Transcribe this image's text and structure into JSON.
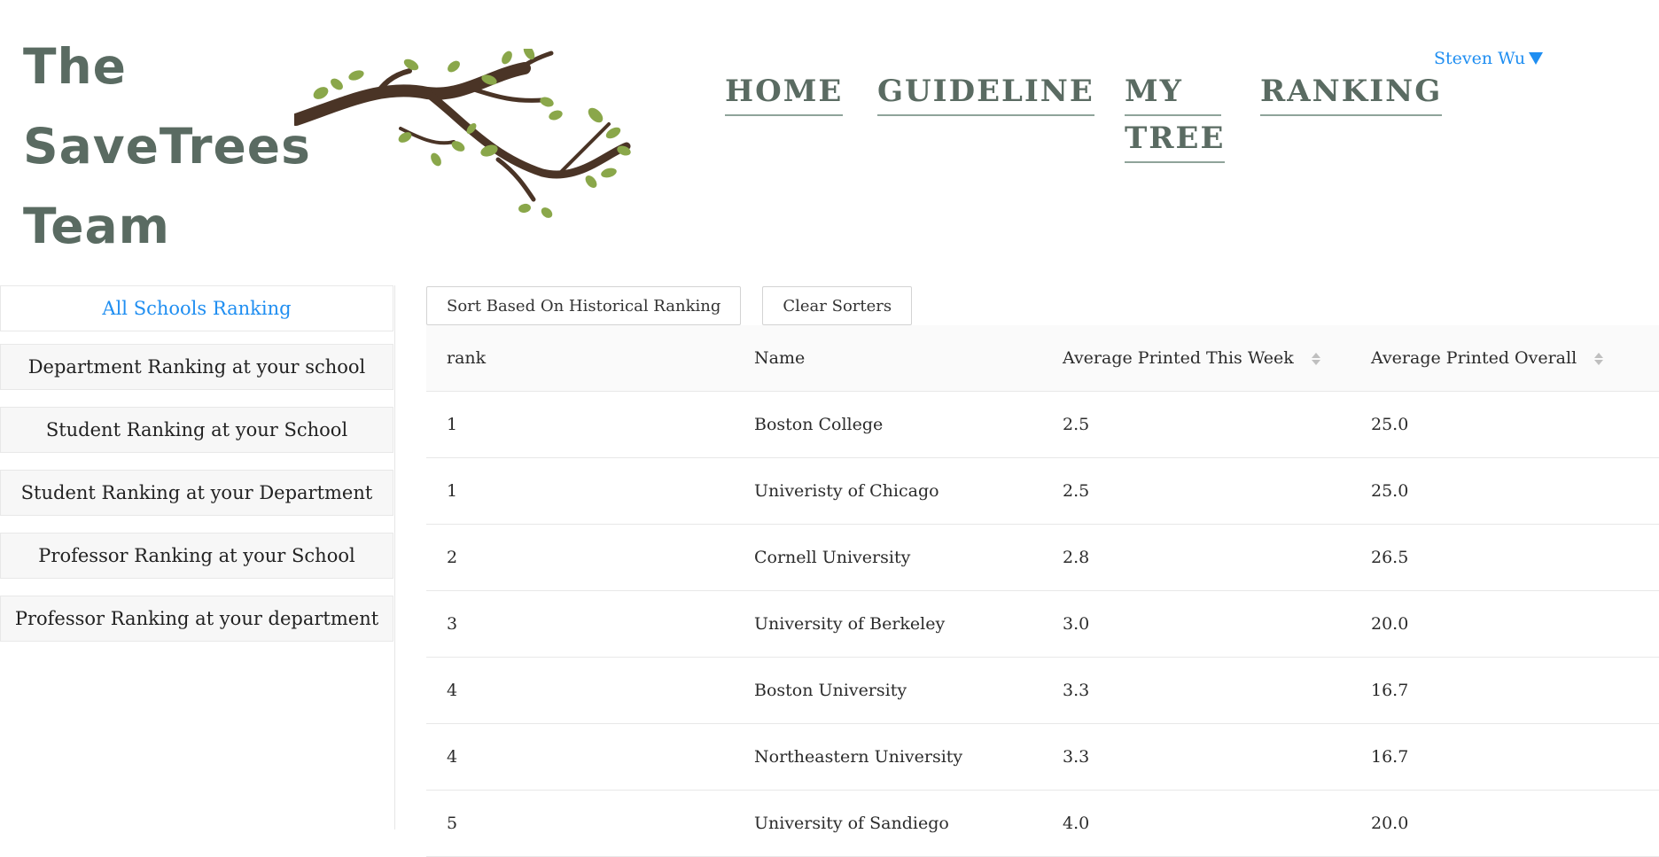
{
  "brand": {
    "line1": "The",
    "line2": "SaveTrees",
    "line3": "Team",
    "logo_icon": "tree-branch-icon"
  },
  "nav": {
    "home": "HOME",
    "guideline": "GUIDELINE",
    "mytree_line1": "MY",
    "mytree_line2": "TREE",
    "ranking": "RANKING"
  },
  "user": {
    "name": "Steven Wu",
    "dropdown_icon": "caret-down-icon"
  },
  "sidebar": {
    "items": [
      {
        "label": "All Schools Ranking",
        "active": true
      },
      {
        "label": "Department Ranking at your school",
        "active": false
      },
      {
        "label": "Student Ranking at your School",
        "active": false
      },
      {
        "label": "Student Ranking at your Department",
        "active": false
      },
      {
        "label": "Professor Ranking at your School",
        "active": false
      },
      {
        "label": "Professor Ranking at your department",
        "active": false
      }
    ]
  },
  "toolbar": {
    "sort_historical": "Sort Based On Historical Ranking",
    "clear_sorters": "Clear Sorters"
  },
  "table": {
    "columns": [
      "rank",
      "Name",
      "Average Printed This Week",
      "Average Printed Overall"
    ],
    "rows": [
      {
        "rank": "1",
        "name": "Boston College",
        "week": "2.5",
        "overall": "25.0"
      },
      {
        "rank": "1",
        "name": "Univeristy of Chicago",
        "week": "2.5",
        "overall": "25.0"
      },
      {
        "rank": "2",
        "name": "Cornell University",
        "week": "2.8",
        "overall": "26.5"
      },
      {
        "rank": "3",
        "name": "University of Berkeley",
        "week": "3.0",
        "overall": "20.0"
      },
      {
        "rank": "4",
        "name": "Boston University",
        "week": "3.3",
        "overall": "16.7"
      },
      {
        "rank": "4",
        "name": "Northeastern University",
        "week": "3.3",
        "overall": "16.7"
      },
      {
        "rank": "5",
        "name": "University of Sandiego",
        "week": "4.0",
        "overall": "20.0"
      }
    ]
  },
  "colors": {
    "accent": "#1f8ef1",
    "brand_text": "#5a6b62",
    "branch": "#4a3426",
    "leaf": "#8aa74a"
  }
}
